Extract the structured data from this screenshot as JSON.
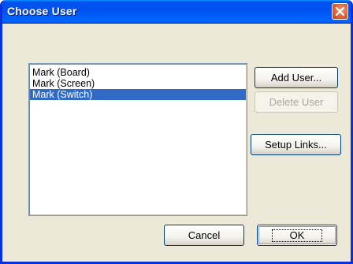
{
  "window": {
    "title": "Choose User",
    "close_label": "close"
  },
  "users": {
    "items": [
      {
        "label": "Mark (Board)",
        "selected": false
      },
      {
        "label": "Mark (Screen)",
        "selected": false
      },
      {
        "label": "Mark (Switch)",
        "selected": true
      }
    ]
  },
  "buttons": {
    "add_user": "Add User...",
    "delete_user": "Delete User",
    "setup_links": "Setup Links...",
    "cancel": "Cancel",
    "ok": "OK"
  },
  "colors": {
    "titlebar": "#0054e3",
    "selection": "#316ac5",
    "dialog_bg": "#ece9d8",
    "close_button": "#e36a3e",
    "disabled_text": "#aca899"
  },
  "icons": {
    "close": "close-icon"
  }
}
